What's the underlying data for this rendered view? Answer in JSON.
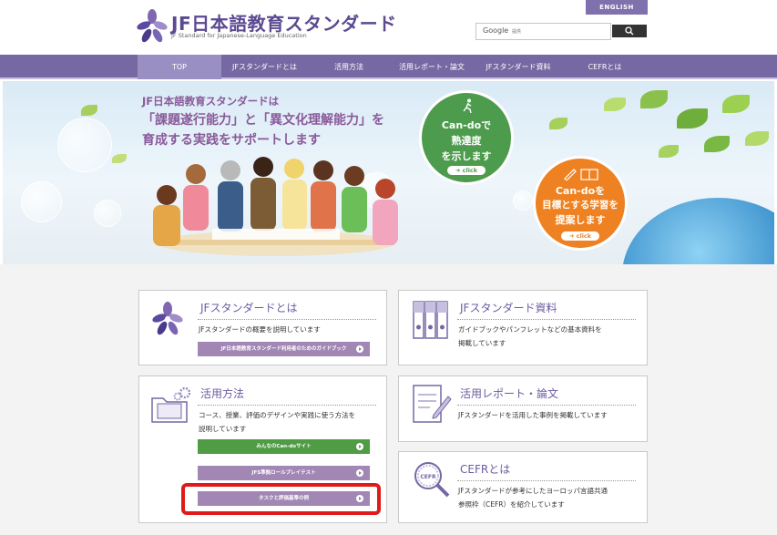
{
  "header": {
    "logo_title": "JF日本語教育スタンダード",
    "logo_subtitle": "JF Standard for Japanese-Language Education",
    "english_label": "ENGLISH",
    "search_brand": "Google",
    "search_placeholder": "提供"
  },
  "nav": {
    "items": [
      "TOP",
      "JFスタンダードとは",
      "活用方法",
      "活用レポート・論文",
      "JFスタンダード資料",
      "CEFRとは"
    ],
    "active": "TOP"
  },
  "hero": {
    "line1": "JF日本語教育スタンダードは",
    "line2": "「課題遂行能力」と「異文化理解能力」を",
    "line3": "育成する実践をサポートします",
    "circle1_lines": [
      "Can-doで",
      "熟達度",
      "を示します"
    ],
    "circle2_lines": [
      "Can-doを",
      "目標とする学習を",
      "提案します"
    ],
    "click_label": "click"
  },
  "cards": {
    "about": {
      "title": "JFスタンダードとは",
      "desc": "JFスタンダードの概要を説明しています",
      "button": "JF日本語教育スタンダード利用者のためのガイドブック"
    },
    "materials": {
      "title": "JFスタンダード資料",
      "desc": [
        "ガイドブックやパンフレットなどの基本資料を",
        "掲載しています"
      ]
    },
    "usage": {
      "title": "活用方法",
      "desc": [
        "コース、授業、評価のデザインや実践に使う方法を",
        "説明しています"
      ],
      "buttons": [
        "みんなのCan-doサイト",
        "JFS準拠ロールプレイテスト",
        "タスクと評価基準の例"
      ]
    },
    "reports": {
      "title": "活用レポート・論文",
      "desc": "JFスタンダードを活用した事例を掲載しています"
    },
    "cefr": {
      "title": "CEFRとは",
      "desc": [
        "JFスタンダードが参考にしたヨーロッパ言語共通",
        "参照枠（CEFR）を紹介しています"
      ],
      "icon_text": "CEFR"
    }
  },
  "colors": {
    "brand_purple": "#7568a3",
    "card_title": "#6c5ba0",
    "button_purple": "#a287b5",
    "button_green": "#4f9c45",
    "circle_green": "#4d9c4d",
    "circle_orange": "#ee8222",
    "highlight_red": "#e01a1a"
  }
}
